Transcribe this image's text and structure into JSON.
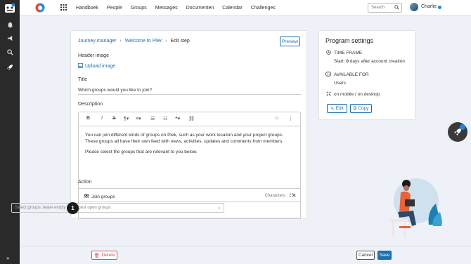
{
  "sidebar": {
    "icons": [
      "app-logo-icon",
      "bell-icon",
      "megaphone-icon",
      "search-icon",
      "rocket-icon"
    ],
    "collapse_label": "»"
  },
  "topnav": {
    "items": [
      "Handboek",
      "People",
      "Groups",
      "Messages",
      "Documenten",
      "Calendar",
      "Challenges"
    ],
    "search_placeholder": "Search",
    "user_name": "Charlie"
  },
  "breadcrumb": {
    "items": [
      "Journey manager",
      "Welcome to Plek",
      "Edit step"
    ]
  },
  "preview_label": "Preview",
  "form": {
    "header_image_label": "Header image",
    "upload_label": "Upload image",
    "title_label": "Title",
    "title_value": "Which groups would you like to join?",
    "description_label": "Description",
    "description_p1": "You can join different kinds of groups on Plek, such as your work location and your project groups. These groups all have their own feed with news, activities, updates and comments from members.",
    "description_p2": "Please select the groups that are relevant to you below.",
    "characters_label": "Characters : 251",
    "action_label": "Action",
    "join_groups_label": "Join groups",
    "select_placeholder": "Select groups, leave empty to suggest open groups",
    "step_badge": "1"
  },
  "program_settings": {
    "title": "Program settings",
    "time_frame_label": "TIME FRAME",
    "start_prefix": "Start:",
    "start_days": "0",
    "start_suffix": "days after account creation",
    "available_label": "AVAILABLE FOR",
    "available_value": "Users",
    "platform": "on mobile / on desktop",
    "edit_label": "Edit",
    "copy_label": "Copy"
  },
  "footer": {
    "delete_label": "Delete",
    "cancel_label": "Cancel",
    "save_label": "Save"
  },
  "colors": {
    "accent": "#1a6fb3",
    "danger": "#d9534f",
    "sidebar": "#2a2a2a"
  }
}
